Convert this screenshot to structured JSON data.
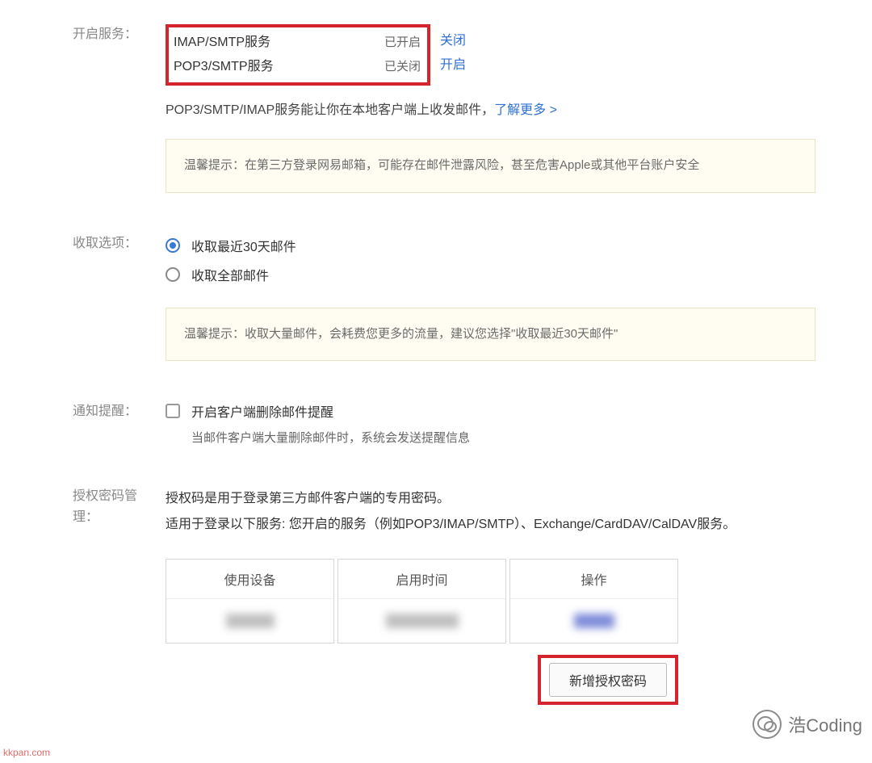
{
  "sections": {
    "service": {
      "label": "开启服务：",
      "rows": [
        {
          "name": "IMAP/SMTP服务",
          "status": "已开启",
          "action": "关闭"
        },
        {
          "name": "POP3/SMTP服务",
          "status": "已关闭",
          "action": "开启"
        }
      ],
      "desc_prefix": "POP3/SMTP/IMAP服务能让你在本地客户端上收发邮件，",
      "desc_link": "了解更多 >",
      "tip": "温馨提示：在第三方登录网易邮箱，可能存在邮件泄露风险，甚至危害Apple或其他平台账户安全"
    },
    "fetch": {
      "label": "收取选项：",
      "options": [
        {
          "text": "收取最近30天邮件",
          "selected": true
        },
        {
          "text": "收取全部邮件",
          "selected": false
        }
      ],
      "tip": "温馨提示：收取大量邮件，会耗费您更多的流量，建议您选择\"收取最近30天邮件\""
    },
    "notify": {
      "label": "通知提醒：",
      "checkbox_text": "开启客户端删除邮件提醒",
      "sub_text": "当邮件客户端大量删除邮件时，系统会发送提醒信息"
    },
    "auth": {
      "label": "授权密码管理：",
      "line1": "授权码是用于登录第三方邮件客户端的专用密码。",
      "line2": "适用于登录以下服务: 您开启的服务（例如POP3/IMAP/SMTP）、Exchange/CardDAV/CalDAV服务。",
      "headers": [
        "使用设备",
        "启用时间",
        "操作"
      ],
      "add_button": "新增授权密码"
    }
  },
  "watermark": {
    "left": "kkpan.com",
    "right": "浩Coding"
  }
}
